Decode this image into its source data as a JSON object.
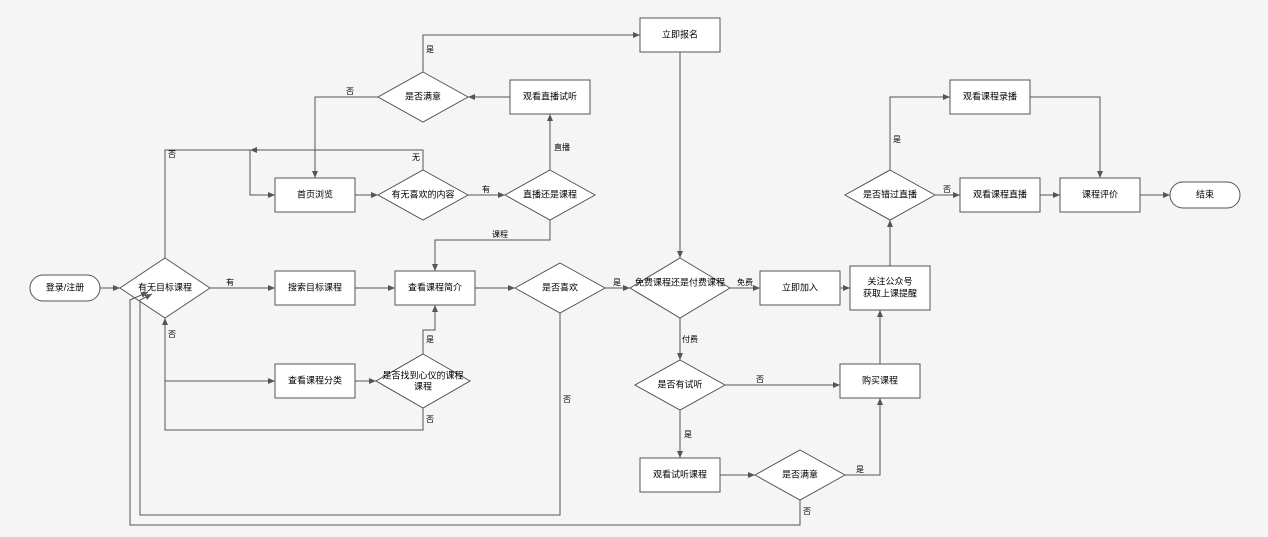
{
  "nodes": {
    "start": {
      "label": "登录/注册"
    },
    "hasTarget": {
      "label": "有无目标课程"
    },
    "browseHome": {
      "label": "首页浏览"
    },
    "searchTarget": {
      "label": "搜索目标课程"
    },
    "viewCat": {
      "label": "查看课程分类"
    },
    "hasLike": {
      "label": "有无喜欢的内容"
    },
    "liveOrCourse": {
      "label": "直播还是课程"
    },
    "watchTrial": {
      "label": "观看直播试听"
    },
    "satisfied1": {
      "label": "是否满意"
    },
    "viewIntro": {
      "label": "查看课程简介"
    },
    "foundHeart": {
      "label": "是否找到心仪的课程"
    },
    "likeIt": {
      "label": "是否喜欢"
    },
    "enrollNow": {
      "label": "立即报名"
    },
    "freeOrPaid": {
      "label": "免费课程还是付费课程"
    },
    "hasTrial": {
      "label": "是否有试听"
    },
    "watchTrialCourse": {
      "label": "观看试听课程"
    },
    "satisfied2": {
      "label": "是否满意"
    },
    "buyCourse": {
      "label": "购买课程"
    },
    "joinNow": {
      "label": "立即加入"
    },
    "follow": {
      "label": "关注公众号\n获取上课提醒"
    },
    "missedLive": {
      "label": "是否错过直播"
    },
    "watchReplay": {
      "label": "观看课程录播"
    },
    "watchLive": {
      "label": "观看课程直播"
    },
    "review": {
      "label": "课程评价"
    },
    "end": {
      "label": "结束"
    }
  },
  "edges": {
    "yes": "是",
    "no": "否",
    "have": "有",
    "none": "无",
    "live": "直播",
    "course": "课程",
    "free": "免费",
    "paid": "付费"
  }
}
